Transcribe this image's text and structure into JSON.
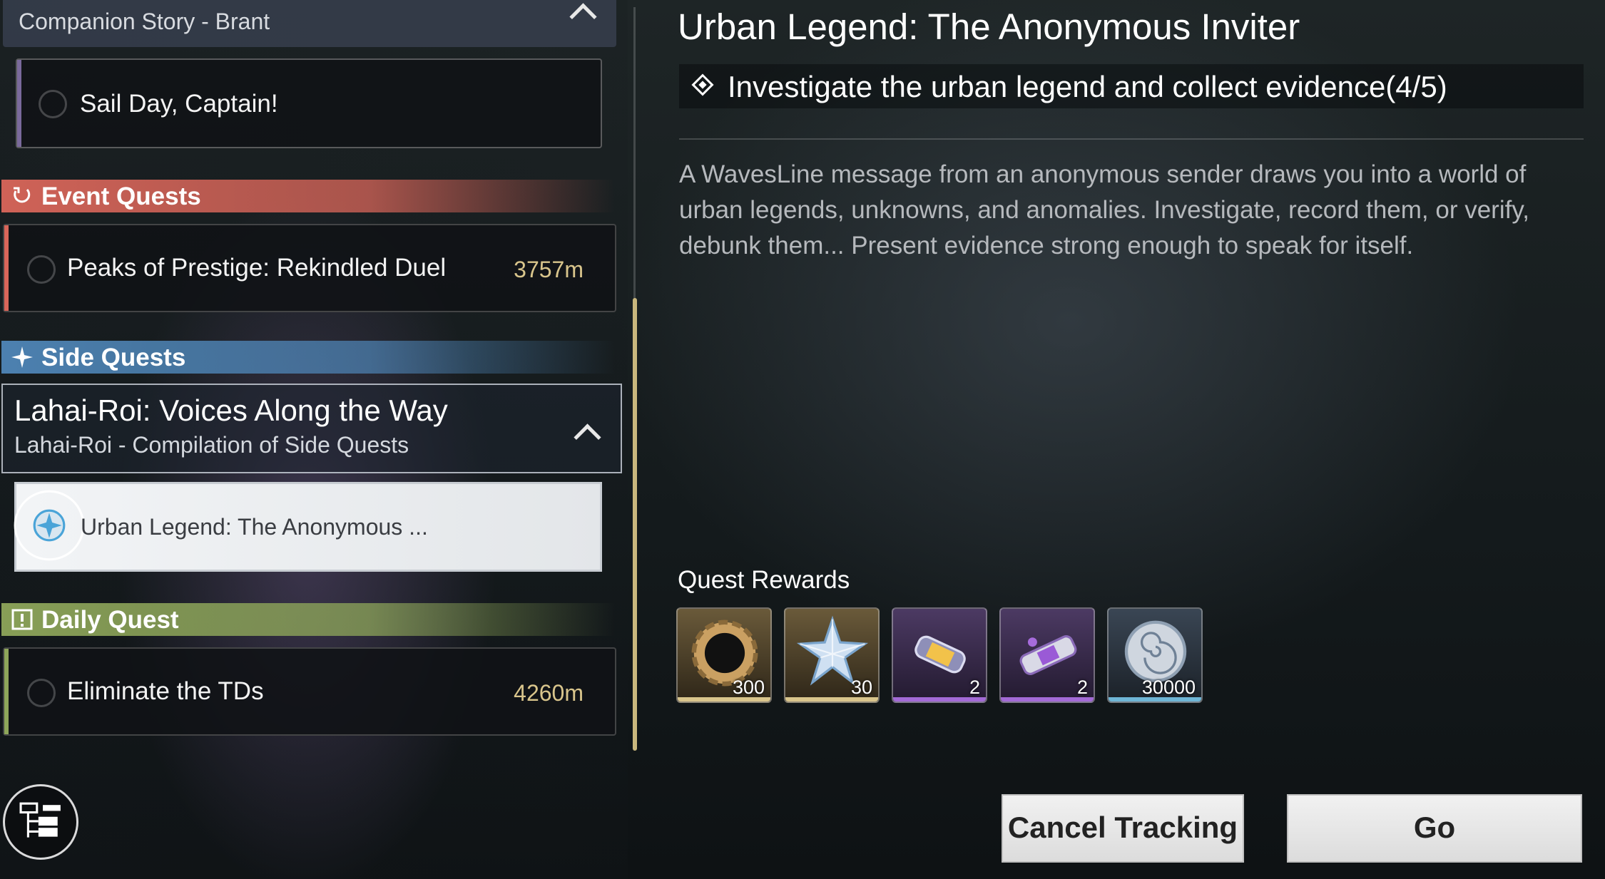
{
  "left_panel": {
    "companion_group": {
      "subtitle": "Companion Story - Brant"
    },
    "companion_quest": {
      "title": "Sail Day, Captain!"
    },
    "sections": {
      "event": {
        "label": "Event Quests",
        "color": "#d9665a"
      },
      "side": {
        "label": "Side Quests",
        "color": "#4f86b8"
      },
      "daily": {
        "label": "Daily Quest",
        "color": "#8ea65a"
      }
    },
    "event_quest": {
      "title": "Peaks of Prestige: Rekindled Duel",
      "distance": "3757m"
    },
    "side_group": {
      "title": "Lahai-Roi: Voices Along the Way",
      "subtitle": "Lahai-Roi - Compilation of Side Quests"
    },
    "side_quest_selected": {
      "title": "Urban Legend: The Anonymous ..."
    },
    "daily_quest": {
      "title": "Eliminate the TDs",
      "distance": "4260m"
    }
  },
  "detail": {
    "title": "Urban Legend: The Anonymous Inviter",
    "objective": "Investigate the urban legend and collect evidence(4/5)",
    "description": "A WavesLine message from an anonymous sender draws you into a world of urban legends, unknowns, and anomalies. Investigate, record them, or verify, debunk them... Present evidence strong enough to speak for itself.",
    "rewards_label": "Quest Rewards",
    "rewards": [
      {
        "icon": "dark-ring-icon",
        "count": "300",
        "rarity_color": "#d9c58c"
      },
      {
        "icon": "crystal-star-icon",
        "count": "30",
        "rarity_color": "#d9c58c"
      },
      {
        "icon": "energy-capsule-icon",
        "count": "2",
        "rarity_color": "#a36ad6"
      },
      {
        "icon": "resonance-capsule-icon",
        "count": "2",
        "rarity_color": "#a36ad6"
      },
      {
        "icon": "shell-credit-icon",
        "count": "30000",
        "rarity_color": "#6fb6d6"
      }
    ]
  },
  "buttons": {
    "cancel_tracking": "Cancel Tracking",
    "go": "Go"
  }
}
